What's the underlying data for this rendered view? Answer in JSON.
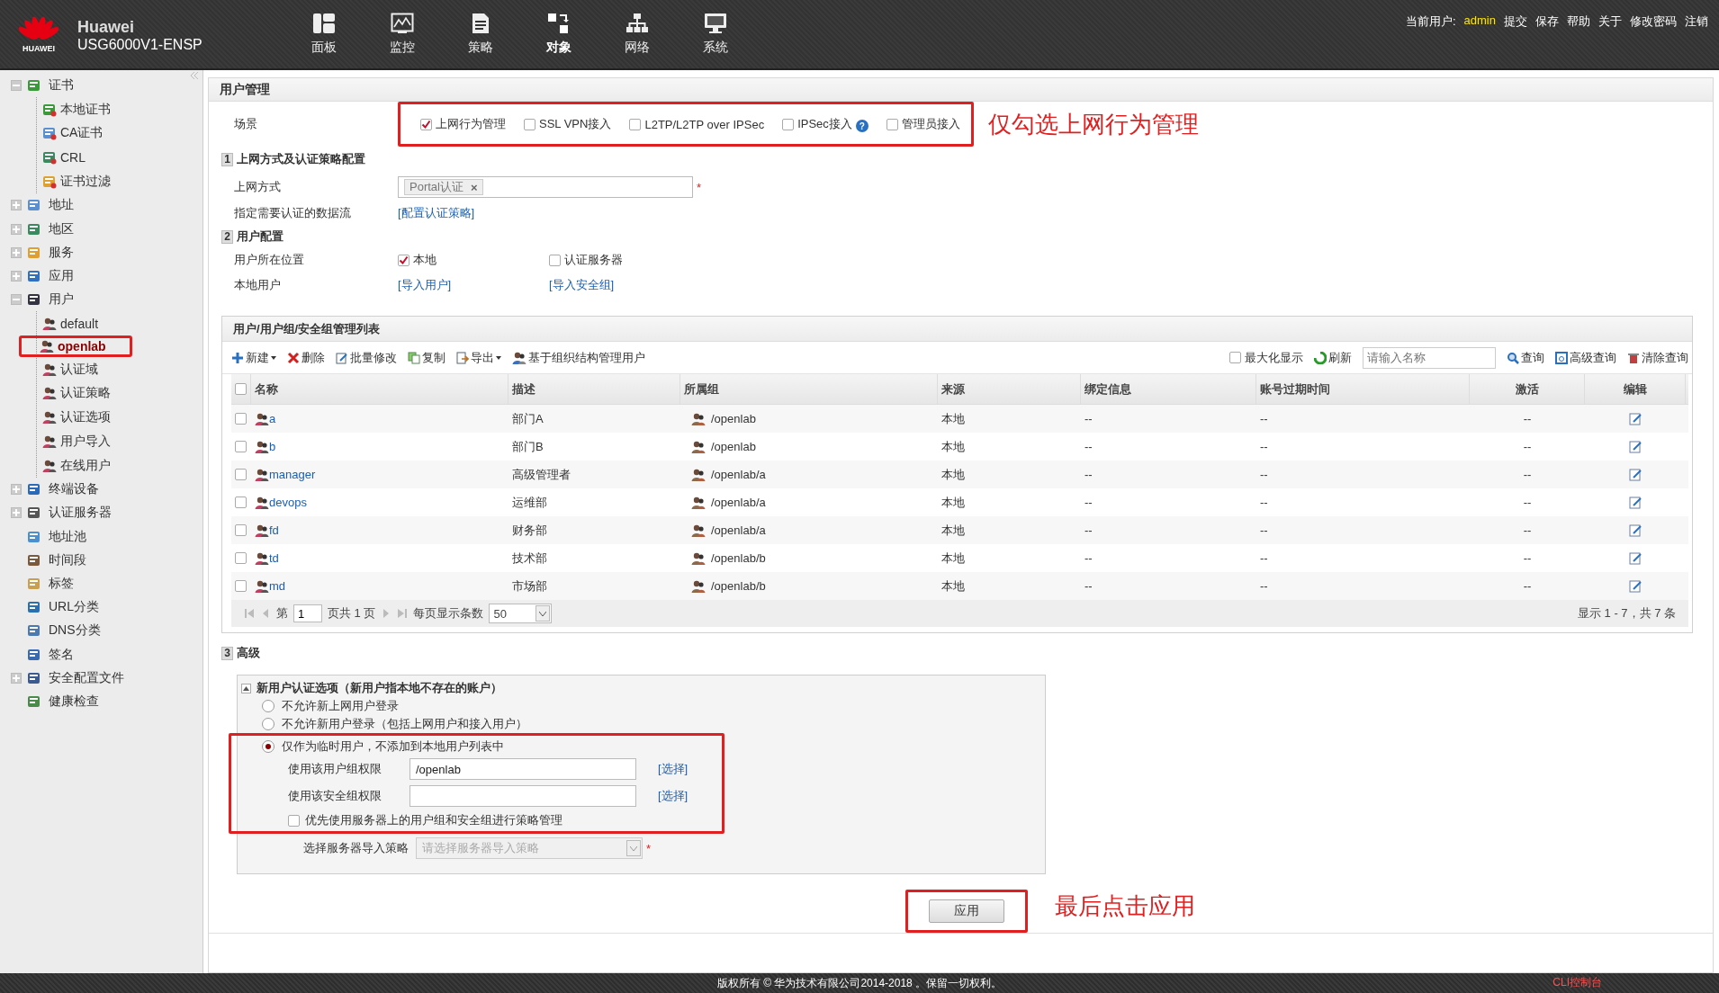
{
  "header": {
    "logo_text": "HUAWEI",
    "brand": "Huawei",
    "model": "USG6000V1-ENSP",
    "nav": [
      {
        "label": "面板",
        "selected": false
      },
      {
        "label": "监控",
        "selected": false
      },
      {
        "label": "策略",
        "selected": false
      },
      {
        "label": "对象",
        "selected": true
      },
      {
        "label": "网络",
        "selected": false
      },
      {
        "label": "系统",
        "selected": false
      }
    ],
    "user_label": "当前用户:",
    "user": "admin",
    "links": [
      "提交",
      "保存",
      "帮助",
      "关于",
      "修改密码",
      "注销"
    ]
  },
  "sidebar": {
    "items": [
      {
        "label": "证书",
        "expanded": true,
        "selected": false,
        "children": [
          {
            "label": "本地证书",
            "selected": false
          },
          {
            "label": "CA证书",
            "selected": false
          },
          {
            "label": "CRL",
            "selected": false
          },
          {
            "label": "证书过滤",
            "selected": false
          }
        ]
      },
      {
        "label": "地址",
        "expanded": false,
        "selected": false
      },
      {
        "label": "地区",
        "expanded": false,
        "selected": false
      },
      {
        "label": "服务",
        "expanded": false,
        "selected": false
      },
      {
        "label": "应用",
        "expanded": false,
        "selected": false
      },
      {
        "label": "用户",
        "expanded": true,
        "selected": false,
        "children": [
          {
            "label": "default",
            "selected": false
          },
          {
            "label": "openlab",
            "selected": true,
            "annotated": true
          },
          {
            "label": "认证域",
            "selected": false
          },
          {
            "label": "认证策略",
            "selected": false
          },
          {
            "label": "认证选项",
            "selected": false
          },
          {
            "label": "用户导入",
            "selected": false
          },
          {
            "label": "在线用户",
            "selected": false
          }
        ]
      },
      {
        "label": "终端设备",
        "expanded": false,
        "selected": false
      },
      {
        "label": "认证服务器",
        "expanded": false,
        "selected": false
      },
      {
        "label": "地址池",
        "selected": false
      },
      {
        "label": "时间段",
        "selected": false
      },
      {
        "label": "标签",
        "selected": false
      },
      {
        "label": "URL分类",
        "selected": false
      },
      {
        "label": "DNS分类",
        "selected": false
      },
      {
        "label": "签名",
        "selected": false
      },
      {
        "label": "安全配置文件",
        "expanded": false,
        "selected": false
      },
      {
        "label": "健康检查",
        "selected": false
      }
    ]
  },
  "page": {
    "title": "用户管理",
    "scene": {
      "label": "场景",
      "annotated": true,
      "annotation": "仅勾选上网行为管理",
      "options": [
        {
          "label": "上网行为管理",
          "checked": true
        },
        {
          "label": "SSL VPN接入",
          "checked": false
        },
        {
          "label": "L2TP/L2TP over IPSec",
          "checked": false
        },
        {
          "label": "IPSec接入",
          "checked": false,
          "help": "?"
        },
        {
          "label": "管理员接入",
          "checked": false
        }
      ]
    },
    "section1": {
      "number": "1",
      "title": "上网方式及认证策略配置",
      "access_label": "上网方式",
      "access_tag": "Portal认证",
      "tag_remove": "×",
      "required": "*",
      "flow_label": "指定需要认证的数据流",
      "flow_link": "[配置认证策略]"
    },
    "section2": {
      "number": "2",
      "title": "用户配置",
      "location_label": "用户所在位置",
      "locations": [
        {
          "label": "本地",
          "checked": true
        },
        {
          "label": "认证服务器",
          "checked": false
        }
      ],
      "local_label": "本地用户",
      "links": [
        "[导入用户]",
        "[导入安全组]"
      ]
    },
    "table": {
      "title": "用户/用户组/安全组管理列表",
      "toolbar": [
        {
          "label": "新建",
          "dropdown": true
        },
        {
          "label": "删除",
          "dropdown": false
        },
        {
          "label": "批量修改",
          "dropdown": false
        },
        {
          "label": "复制",
          "dropdown": false
        },
        {
          "label": "导出",
          "dropdown": true
        },
        {
          "label": "基于组织结构管理用户",
          "dropdown": false
        }
      ],
      "maximize": {
        "label": "最大化显示",
        "checked": false
      },
      "refresh": "刷新",
      "search_placeholder": "请输入名称",
      "query": "查询",
      "advanced_query": "高级查询",
      "clear_query": "清除查询",
      "select_all_checked": false,
      "columns": [
        "名称",
        "描述",
        "所属组",
        "来源",
        "绑定信息",
        "账号过期时间",
        "激活",
        "编辑"
      ],
      "rows": [
        {
          "name": "a",
          "desc": "部门A",
          "group": "/openlab",
          "source": "本地",
          "binding": "--",
          "expiry": "--",
          "active": "--",
          "checked": false
        },
        {
          "name": "b",
          "desc": "部门B",
          "group": "/openlab",
          "source": "本地",
          "binding": "--",
          "expiry": "--",
          "active": "--",
          "checked": false
        },
        {
          "name": "manager",
          "desc": "高级管理者",
          "group": "/openlab/a",
          "source": "本地",
          "binding": "--",
          "expiry": "--",
          "active": "--",
          "checked": false
        },
        {
          "name": "devops",
          "desc": "运维部",
          "group": "/openlab/a",
          "source": "本地",
          "binding": "--",
          "expiry": "--",
          "active": "--",
          "checked": false
        },
        {
          "name": "fd",
          "desc": "财务部",
          "group": "/openlab/a",
          "source": "本地",
          "binding": "--",
          "expiry": "--",
          "active": "--",
          "checked": false
        },
        {
          "name": "td",
          "desc": "技术部",
          "group": "/openlab/b",
          "source": "本地",
          "binding": "--",
          "expiry": "--",
          "active": "--",
          "checked": false
        },
        {
          "name": "md",
          "desc": "市场部",
          "group": "/openlab/b",
          "source": "本地",
          "binding": "--",
          "expiry": "--",
          "active": "--",
          "checked": false
        }
      ],
      "pager": {
        "page_prefix": "第",
        "page": "1",
        "page_suffix": "页共 1 页",
        "per_page_label": "每页显示条数",
        "per_page": "50",
        "summary": "显示 1 - 7，共 7 条"
      }
    },
    "advanced": {
      "number": "3",
      "title": "高级",
      "group_title": "新用户认证选项（新用户指本地不存在的账户）",
      "expanded": true,
      "options": [
        {
          "label": "不允许新上网用户登录",
          "selected": false
        },
        {
          "label": "不允许新用户登录（包括上网用户和接入用户）",
          "selected": false
        },
        {
          "label": "仅作为临时用户，不添加到本地用户列表中",
          "selected": true,
          "annotated": true
        }
      ],
      "user_group_label": "使用该用户组权限",
      "user_group": "/openlab",
      "user_group_link": "[选择]",
      "security_group_label": "使用该安全组权限",
      "security_group_link": "[选择]",
      "prefer_server": {
        "label": "优先使用服务器上的用户组和安全组进行策略管理",
        "checked": false
      },
      "import_policy_label": "选择服务器导入策略",
      "import_policy_placeholder": "请选择服务器导入策略",
      "required": "*"
    },
    "apply": {
      "label": "应用",
      "annotated": true,
      "annotation": "最后点击应用"
    }
  },
  "footer": {
    "copyright": "版权所有 © 华为技术有限公司2014-2018 。保留一切权利。",
    "cli": "CLI控制台"
  }
}
